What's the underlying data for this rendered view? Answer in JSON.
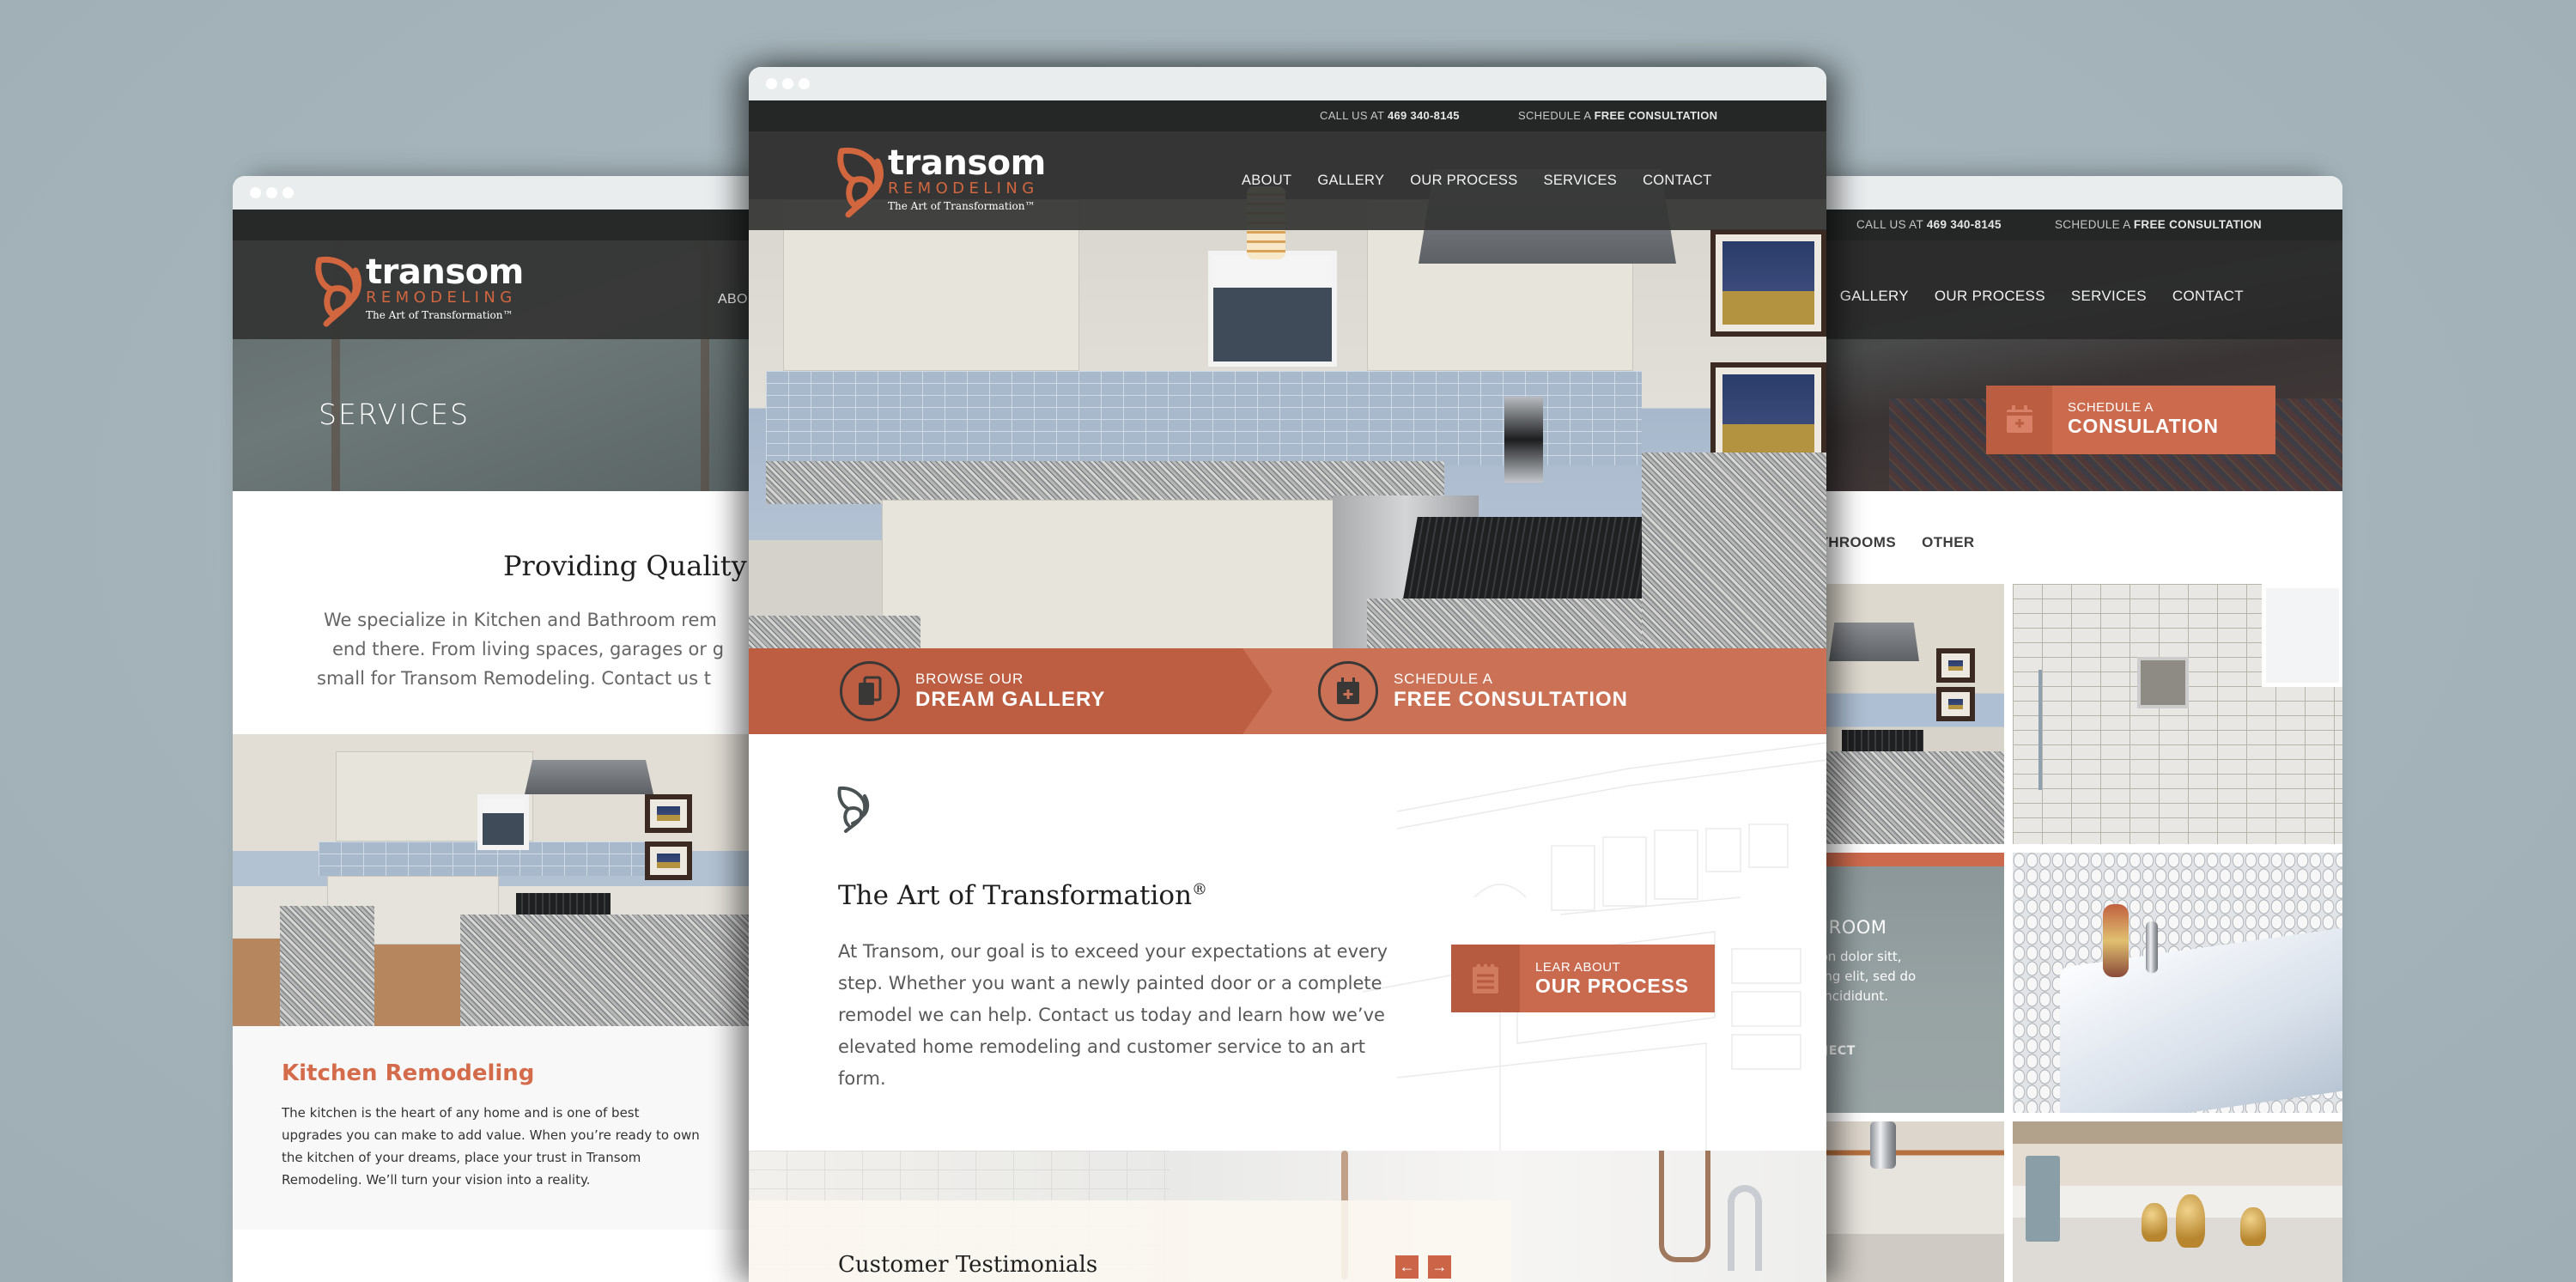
{
  "brand": {
    "name": "transom",
    "subname": "REMODELING",
    "tagline": "The Art of Transformation™",
    "accent_color": "#d2663f"
  },
  "topbar": {
    "call_prefix": "CALL US AT ",
    "phone": "469 340-8145",
    "schedule_prefix": "SCHEDULE A ",
    "schedule_link": "FREE CONSULTATION"
  },
  "nav": {
    "items": [
      "ABOUT",
      "GALLERY",
      "OUR PROCESS",
      "SERVICES",
      "CONTACT"
    ],
    "left_partial": "ABO",
    "right_partial": "T"
  },
  "center_page": {
    "cta_gallery": {
      "line1": "BROWSE OUR",
      "line2": "DREAM GALLERY",
      "icon": "gallery-icon"
    },
    "cta_consult": {
      "line1": "SCHEDULE A",
      "line2": "FREE CONSULTATION",
      "icon": "calendar-plus-icon"
    },
    "intro": {
      "icon": "butterfly-icon",
      "title": "The Art of Transformation",
      "title_mark": "®",
      "body": "At Transom, our goal is to exceed your expectations at every step. Whether you want a newly painted door or a complete remodel we can help. Contact us today and learn how we’ve elevated home remodeling and customer service to an art form."
    },
    "process_button": {
      "line1": "LEAR ABOUT",
      "line2": "OUR PROCESS",
      "icon": "notepad-icon"
    },
    "testimonials": {
      "title": "Customer Testimonials",
      "prev": "←",
      "next": "→"
    }
  },
  "left_page": {
    "hero_title": "SERVICES",
    "section_title": "Providing Quality S",
    "section_body_lines": [
      "We specialize in Kitchen and Bathroom rem",
      "end there. From living spaces, garages or g",
      "small for Transom Remodeling. Contact us t"
    ],
    "service_card": {
      "title": "Kitchen Remodeling",
      "body": "The kitchen is the heart of any home and is one of best upgrades you can make to add value. When you’re ready to own the kitchen of your dreams, place your trust in Transom Remodeling. We’ll turn your vision into a reality."
    }
  },
  "right_page": {
    "consult_button": {
      "line1": "SCHEDULE A",
      "line2": "CONSULATION",
      "icon": "calendar-plus-icon"
    },
    "filters": [
      "ATHROOMS",
      "OTHER"
    ],
    "project_card": {
      "title": "THROOM",
      "body_lines": [
        "ption dolor sitt,",
        "sicing elit, sed do",
        "or incididunt."
      ],
      "link": "ROJECT"
    }
  }
}
